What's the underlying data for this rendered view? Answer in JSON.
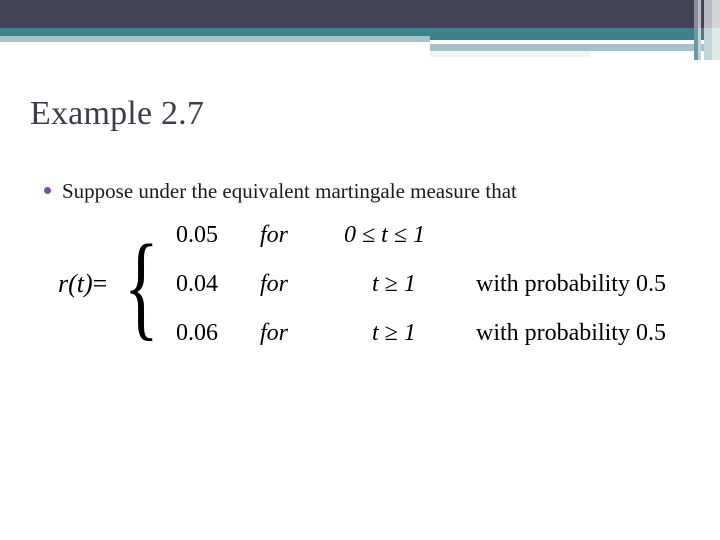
{
  "slide": {
    "title": "Example 2.7",
    "bullets": [
      {
        "marker": "bullet-dot",
        "text": "Suppose under the equivalent martingale measure that"
      }
    ],
    "equation": {
      "lhs_function": "r(t)",
      "lhs_equals": "=",
      "brace": "{",
      "cases": [
        {
          "value": "0.05",
          "keyword": "for",
          "condition": "0 ≤ t ≤ 1",
          "probability_label": "",
          "probability_value": ""
        },
        {
          "value": "0.04",
          "keyword": "for",
          "condition": "t ≥ 1",
          "probability_label": "with probability",
          "probability_value": "0.5"
        },
        {
          "value": "0.06",
          "keyword": "for",
          "condition": "t ≥ 1",
          "probability_label": "with probability",
          "probability_value": "0.5"
        }
      ]
    }
  },
  "theme": {
    "navy": "#434257",
    "teal": "#3f808a",
    "steel": "#a7c2c6",
    "pale": "#eef4f5",
    "stripe_grey": "#8b8c9c",
    "stripe_light": "#b9bac4",
    "title_color": "#3c3c4c",
    "bullet_color": "#7b4f9d",
    "body_color": "#1a1a1a",
    "background": "#ffffff"
  }
}
